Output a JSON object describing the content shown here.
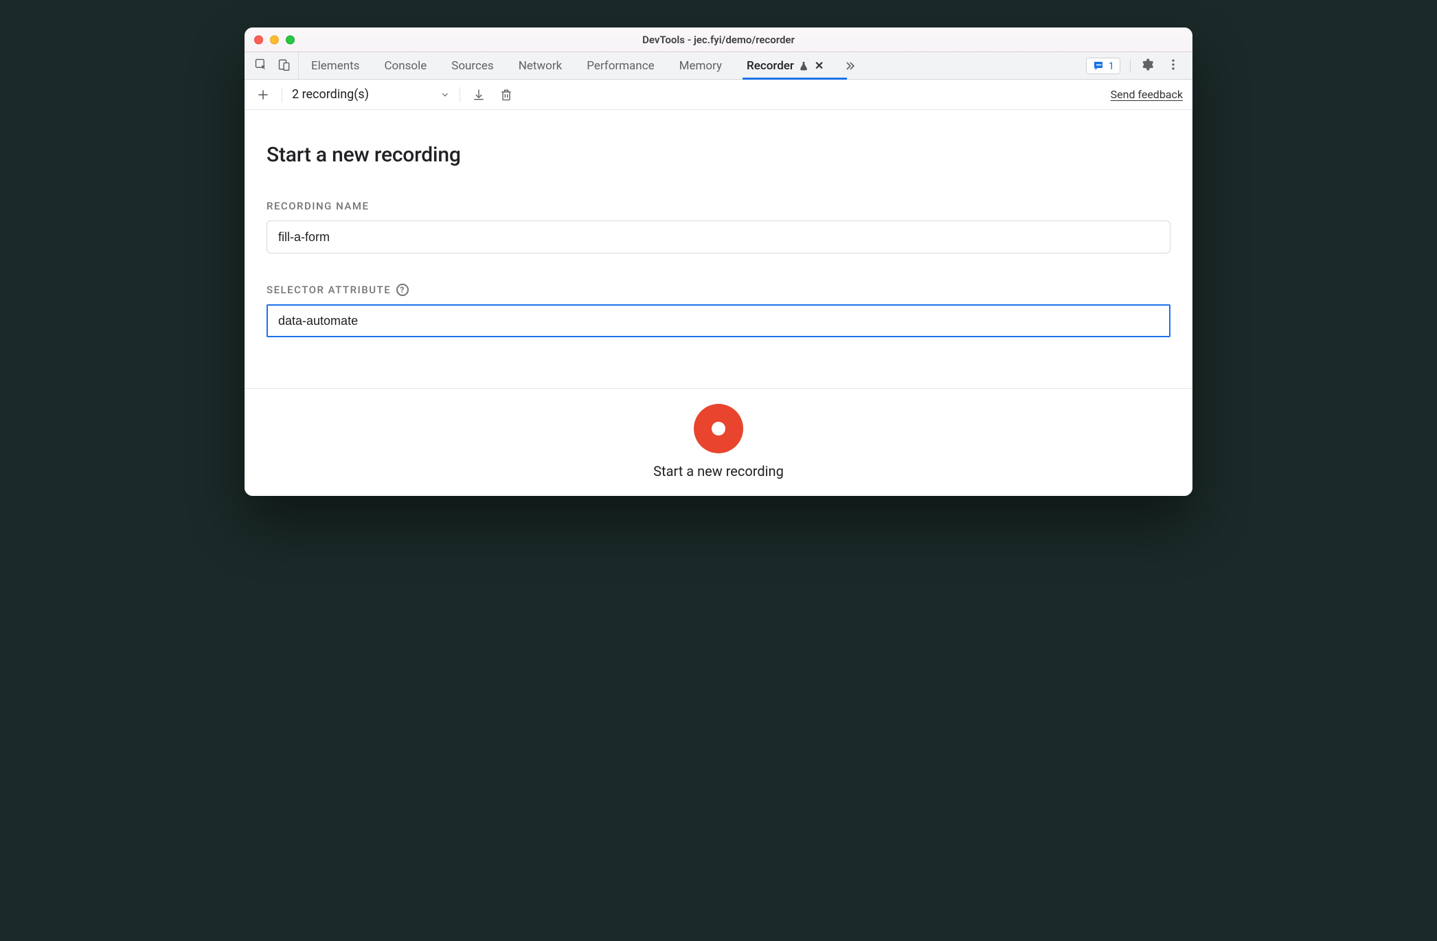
{
  "window": {
    "title": "DevTools - jec.fyi/demo/recorder"
  },
  "tabstrip": {
    "tabs": [
      {
        "label": "Elements"
      },
      {
        "label": "Console"
      },
      {
        "label": "Sources"
      },
      {
        "label": "Network"
      },
      {
        "label": "Performance"
      },
      {
        "label": "Memory"
      },
      {
        "label": "Recorder",
        "active": true,
        "experiment": true,
        "closable": true
      }
    ],
    "issues_count": "1"
  },
  "toolbar": {
    "recordings_label": "2 recording(s)",
    "feedback_label": "Send feedback"
  },
  "main": {
    "heading": "Start a new recording",
    "name_label": "Recording name",
    "name_value": "fill-a-form",
    "selector_label": "Selector attribute",
    "selector_value": "data-automate"
  },
  "footer": {
    "record_label": "Start a new recording"
  }
}
